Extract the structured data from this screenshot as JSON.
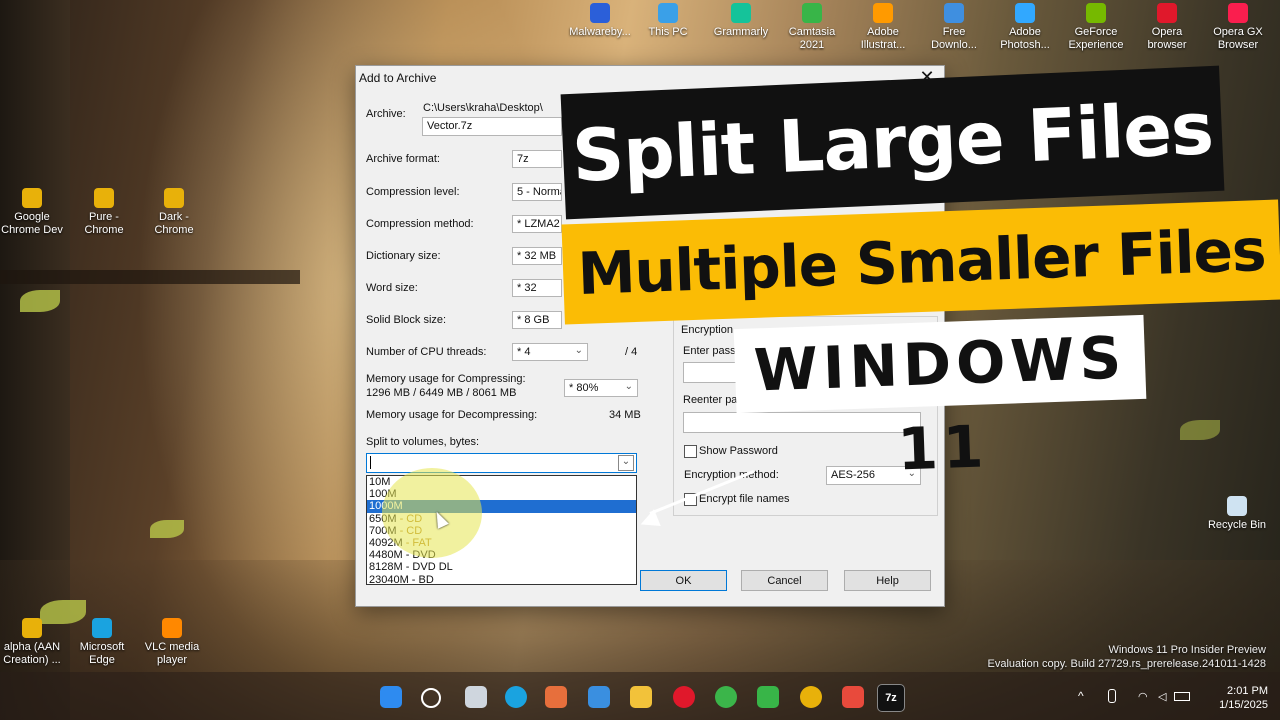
{
  "desktop_icons": [
    {
      "label": "Malwareby...",
      "color": "#2b5fd9"
    },
    {
      "label": "This PC",
      "color": "#3aa0e8"
    },
    {
      "label": "Grammarly",
      "color": "#15c39a"
    },
    {
      "label": "Camtasia 2021",
      "color": "#38b548"
    },
    {
      "label": "Adobe Illustrat...",
      "color": "#ff9a00"
    },
    {
      "label": "Free Downlo...",
      "color": "#3f8fe0"
    },
    {
      "label": "Adobe Photosh...",
      "color": "#31a8ff"
    },
    {
      "label": "GeForce Experience",
      "color": "#76b900"
    },
    {
      "label": "Opera browser",
      "color": "#e0182b"
    },
    {
      "label": "Opera GX Browser",
      "color": "#fa1e4e"
    },
    {
      "label": "Google Chrome Dev",
      "color": "#e8b10a"
    },
    {
      "label": "Pure - Chrome",
      "color": "#e8b10a"
    },
    {
      "label": "Dark - Chrome",
      "color": "#e8b10a"
    },
    {
      "label": "Recycle Bin",
      "color": "#cfe3f2"
    },
    {
      "label": "alpha (AAN Creation) ...",
      "color": "#e8b10a"
    },
    {
      "label": "Microsoft Edge",
      "color": "#1aa3e0"
    },
    {
      "label": "VLC media player",
      "color": "#ff8800"
    }
  ],
  "dialog": {
    "title": "Add to Archive",
    "archive_label": "Archive:",
    "archive_path": "C:\\Users\\kraha\\Desktop\\",
    "archive_name": "Vector.7z",
    "format_label": "Archive format:",
    "format_value": "7z",
    "level_label": "Compression level:",
    "level_value": "5 - Normal",
    "method_label": "Compression method:",
    "method_value": "* LZMA2",
    "dict_label": "Dictionary size:",
    "dict_value": "* 32 MB",
    "word_label": "Word size:",
    "word_value": "* 32",
    "solid_label": "Solid Block size:",
    "solid_value": "* 8 GB",
    "threads_label": "Number of CPU threads:",
    "threads_value": "* 4",
    "threads_max": "/ 4",
    "mem_comp_label": "Memory usage for Compressing:",
    "mem_comp_value": "1296 MB / 6449 MB / 8061 MB",
    "mem_comp_percent": "* 80%",
    "mem_decomp_label": "Memory usage for Decompressing:",
    "mem_decomp_value": "34 MB",
    "split_label": "Split to volumes, bytes:",
    "split_value": "",
    "split_options": [
      {
        "main": "10M",
        "sub": ""
      },
      {
        "main": "100M",
        "sub": ""
      },
      {
        "main": "1000M",
        "sub": "",
        "selected": true
      },
      {
        "main": "650M",
        "sub": " - CD"
      },
      {
        "main": "700M",
        "sub": " - CD"
      },
      {
        "main": "4092M",
        "sub": " - FAT"
      },
      {
        "main": "4480M - DVD",
        "sub": ""
      },
      {
        "main": "8128M - DVD DL",
        "sub": ""
      },
      {
        "main": "23040M - BD",
        "sub": ""
      }
    ],
    "encryption_label": "Encryption",
    "enter_pass_label": "Enter passw",
    "reenter_pass_label": "Reenter pass",
    "show_password": "Show Password",
    "enc_method_label": "Encryption method:",
    "enc_method_value": "AES-256",
    "encrypt_names": "Encrypt file names",
    "ok": "OK",
    "cancel": "Cancel",
    "help": "Help"
  },
  "banners": {
    "line1": "Split Large Files",
    "line2": "Multiple Smaller Files",
    "line3": "WINDOWS 11"
  },
  "watermark": {
    "line1": "Windows 11 Pro Insider Preview",
    "line2": "Evaluation copy. Build 27729.rs_prerelease.241011-1428"
  },
  "taskbar": {
    "time": "2:01 PM",
    "date": "1/15/2025"
  },
  "colors": {
    "banner_black": "#111111",
    "banner_yellow": "#fbbc05",
    "selection_blue": "#1f6ed1"
  }
}
